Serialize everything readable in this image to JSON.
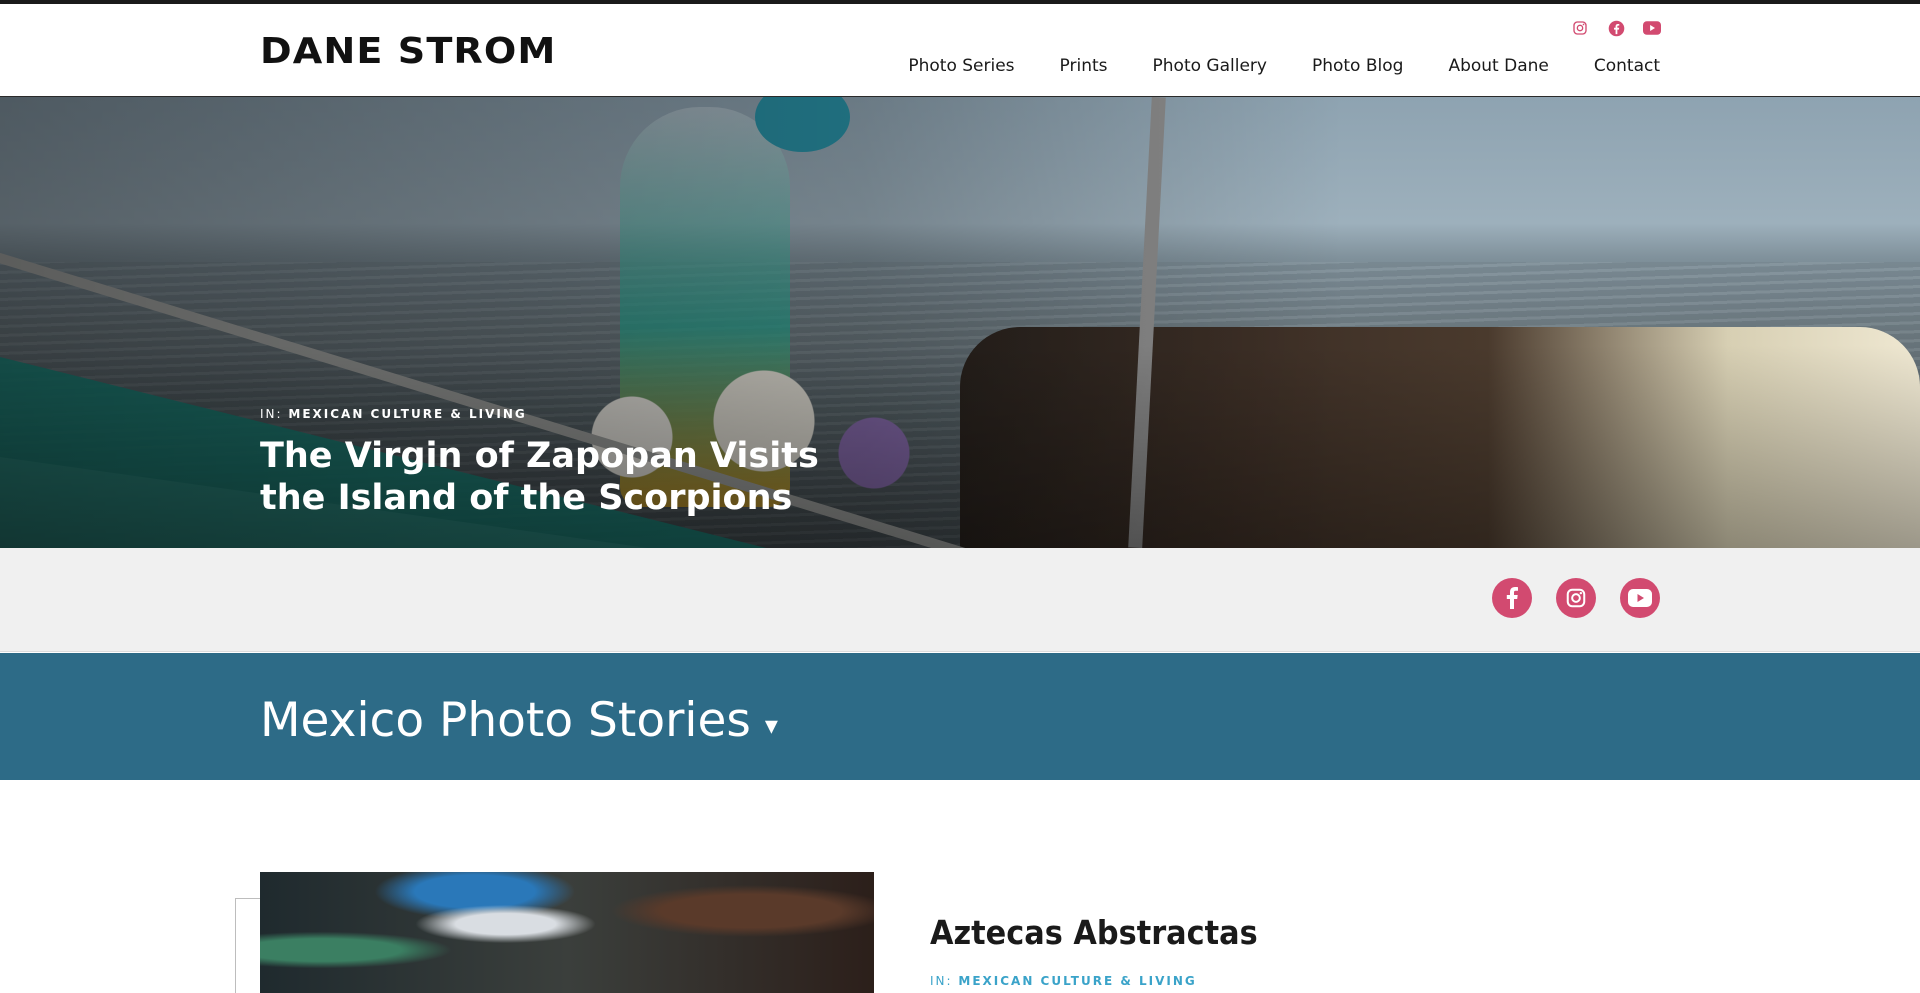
{
  "site": {
    "logo": "DANE STROM"
  },
  "header": {
    "social": [
      {
        "icon": "instagram-icon"
      },
      {
        "icon": "facebook-icon"
      },
      {
        "icon": "youtube-icon"
      }
    ],
    "nav": [
      "Photo Series",
      "Prints",
      "Photo Gallery",
      "Photo Blog",
      "About Dane",
      "Contact"
    ]
  },
  "hero": {
    "category_prefix": "IN:",
    "category": "MEXICAN CULTURE & LIVING",
    "title": "The Virgin of Zapopan Visits the Island of the Scorpions"
  },
  "share": {
    "icons": [
      "facebook-icon",
      "instagram-icon",
      "youtube-icon"
    ]
  },
  "section": {
    "title": "Mexico Photo Stories",
    "caret": "▾"
  },
  "post": {
    "title": "Aztecas Abstractas",
    "category_prefix": "IN:",
    "category": "MEXICAN CULTURE & LIVING"
  },
  "colors": {
    "accent": "#d24a70",
    "band": "#2d6b87",
    "link": "#3aa3c9"
  }
}
